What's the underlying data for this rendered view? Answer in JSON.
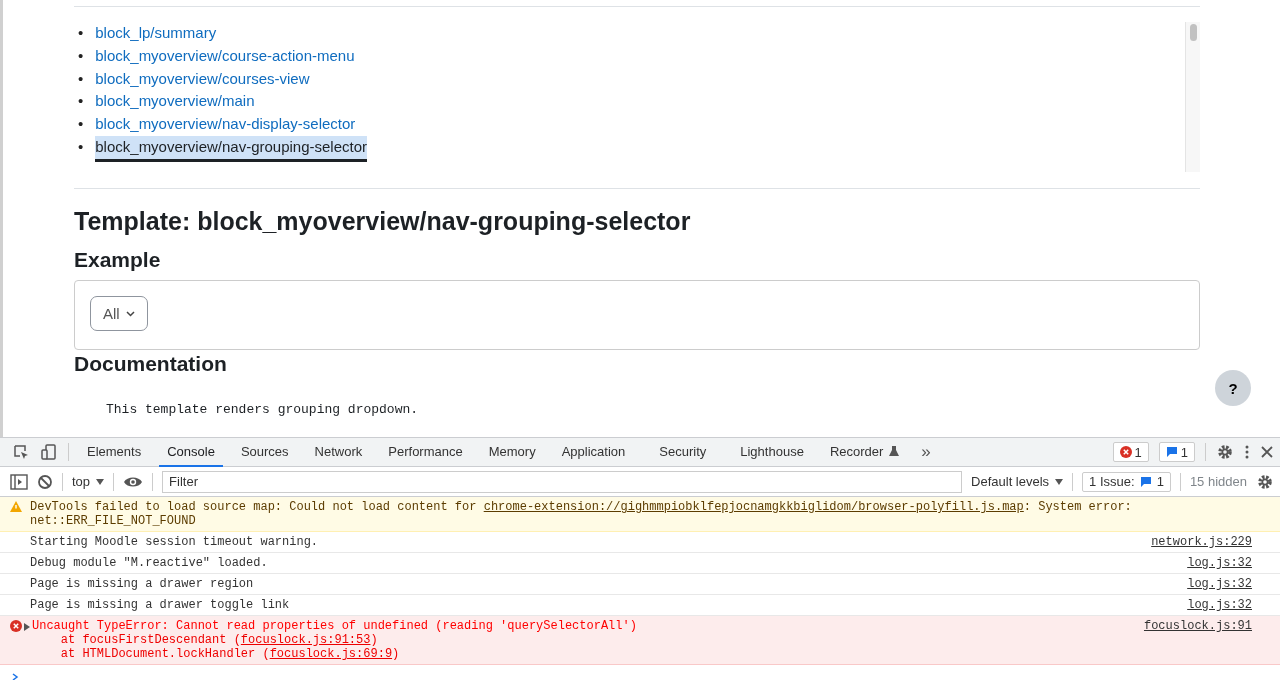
{
  "template_list": {
    "bullet": "•",
    "items": [
      {
        "label": "block_lp/summary",
        "selected": false
      },
      {
        "label": "block_myoverview/course-action-menu",
        "selected": false
      },
      {
        "label": "block_myoverview/courses-view",
        "selected": false
      },
      {
        "label": "block_myoverview/main",
        "selected": false
      },
      {
        "label": "block_myoverview/nav-display-selector",
        "selected": false
      },
      {
        "label": "block_myoverview/nav-grouping-selector",
        "selected": true
      }
    ]
  },
  "title": "Template: block_myoverview/nav-grouping-selector",
  "example": {
    "heading": "Example",
    "dropdown": "All"
  },
  "documentation": {
    "heading": "Documentation",
    "text": "This template renders grouping dropdown."
  },
  "help_button": "?",
  "devtools": {
    "tabs": [
      {
        "label": "Elements",
        "selected": false
      },
      {
        "label": "Console",
        "selected": true
      },
      {
        "label": "Sources",
        "selected": false
      },
      {
        "label": "Network",
        "selected": false
      },
      {
        "label": "Performance",
        "selected": false
      },
      {
        "label": "Memory",
        "selected": false
      },
      {
        "label": "Application",
        "selected": false
      },
      {
        "label": "Security",
        "selected": false
      },
      {
        "label": "Lighthouse",
        "selected": false
      },
      {
        "label": "Recorder",
        "selected": false
      }
    ],
    "more_tabs": "»",
    "error_count": "1",
    "message_count": "1",
    "context": "top",
    "filter_placeholder": "Filter",
    "levels": "Default levels",
    "issues_label": "1 Issue:",
    "issues_count": "1",
    "hidden": "15 hidden",
    "messages": [
      {
        "kind": "warning",
        "expandable": false,
        "lines": [
          [
            {
              "kind": "text",
              "text": "DevTools failed to load source map: Could not load content for "
            },
            {
              "kind": "link",
              "text": "chrome-extension://gighmmpiobklfepjocnamgkkbiglidom/browser-polyfill.js.map"
            },
            {
              "kind": "text",
              "text": ": System error: net::ERR_FILE_NOT_FOUND"
            }
          ]
        ]
      },
      {
        "kind": "log",
        "expandable": false,
        "lines": [
          [
            {
              "kind": "text",
              "text": "Starting Moodle session timeout warning."
            }
          ]
        ],
        "source": "network.js:229"
      },
      {
        "kind": "log",
        "expandable": false,
        "lines": [
          [
            {
              "kind": "text",
              "text": "Debug module \"M.reactive\" loaded."
            }
          ]
        ],
        "source": "log.js:32"
      },
      {
        "kind": "log",
        "expandable": false,
        "lines": [
          [
            {
              "kind": "text",
              "text": "Page is missing a drawer region"
            }
          ]
        ],
        "source": "log.js:32"
      },
      {
        "kind": "log",
        "expandable": false,
        "lines": [
          [
            {
              "kind": "text",
              "text": "Page is missing a drawer toggle link"
            }
          ]
        ],
        "source": "log.js:32"
      },
      {
        "kind": "error",
        "expandable": true,
        "lines": [
          [
            {
              "kind": "text",
              "text": "Uncaught TypeError: Cannot read properties of undefined (reading 'querySelectorAll')"
            }
          ],
          [
            {
              "kind": "text",
              "text": "    at focusFirstDescendant ("
            },
            {
              "kind": "link",
              "text": "focuslock.js:91:53"
            },
            {
              "kind": "text",
              "text": ")"
            }
          ],
          [
            {
              "kind": "text",
              "text": "    at HTMLDocument.lockHandler ("
            },
            {
              "kind": "link",
              "text": "focuslock.js:69:9"
            },
            {
              "kind": "text",
              "text": ")"
            }
          ]
        ],
        "source": "focuslock.js:91"
      }
    ]
  }
}
